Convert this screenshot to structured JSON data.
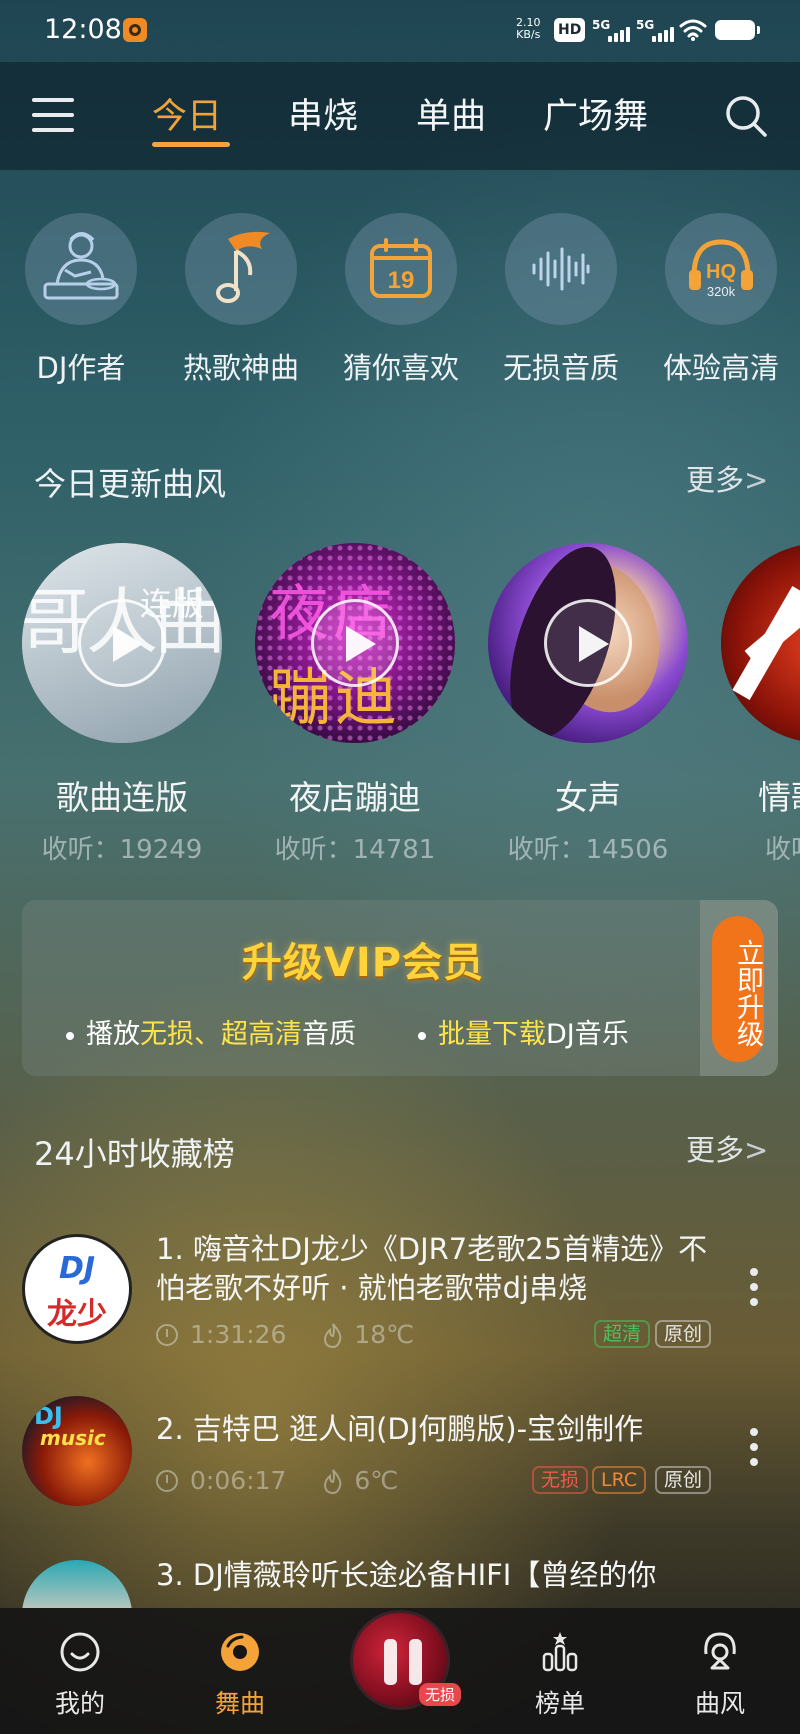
{
  "status_bar": {
    "time": "12:08",
    "net_speed_value": "2.10",
    "net_speed_unit": "KB/s",
    "hd": "HD",
    "sig1": "5G",
    "sig2": "5G"
  },
  "tabs": [
    {
      "label": "今日",
      "active": true
    },
    {
      "label": "串烧"
    },
    {
      "label": "单曲"
    },
    {
      "label": "广场舞"
    }
  ],
  "shortcuts": [
    {
      "label": "DJ作者",
      "icon": "dj-author-icon"
    },
    {
      "label": "热歌神曲",
      "icon": "hot-song-icon"
    },
    {
      "label": "猜你喜欢",
      "icon": "calendar-icon",
      "calendar_day": "19"
    },
    {
      "label": "无损音质",
      "icon": "waveform-icon"
    },
    {
      "label": "体验高清",
      "icon": "hq-headphones-icon",
      "hq": "HQ",
      "bitrate": "320k"
    }
  ],
  "styles_section": {
    "title": "今日更新曲风",
    "more": "更多",
    "more_chev": ">"
  },
  "styles": [
    {
      "name": "歌曲连版",
      "listens": "收听：19249",
      "cover_text_big": "哥人曲",
      "cover_text_small": "连版"
    },
    {
      "name": "夜店蹦迪",
      "listens": "收听：14781",
      "cover_text_top": "夜店",
      "cover_text_bottom": "蹦迪"
    },
    {
      "name": "女声",
      "listens": "收听：14506"
    },
    {
      "name": "情歌",
      "listens": "收听"
    }
  ],
  "vip": {
    "title": "升级VIP会员",
    "perk1_prefix": "播放",
    "perk1_hl1": "无损",
    "perk1_mid": "、",
    "perk1_hl2": "超高清",
    "perk1_suffix": "音质",
    "perk2_hl": "批量下载",
    "perk2_suffix": "DJ音乐",
    "upgrade": "立即升级"
  },
  "chart_section": {
    "title": "24小时收藏榜",
    "more": "更多",
    "more_chev": ">"
  },
  "songs": [
    {
      "title": "1. 嗨音社DJ龙少《DJR7老歌25首精选》不怕老歌不好听 · 就怕老歌带dj串烧",
      "duration": "1:31:26",
      "heat": "18℃",
      "badges": [
        "超清",
        "原创"
      ],
      "cover_text": "DJ",
      "cover_text2": "龙少"
    },
    {
      "title": "2. 吉特巴  逛人间(DJ何鹏版)-宝剑制作",
      "duration": "0:06:17",
      "heat": "6℃",
      "badges": [
        "无损",
        "LRC",
        "原创"
      ],
      "cover_text": "DJ",
      "cover_text2": "music"
    },
    {
      "title": "3. DJ情薇聆听长途必备HIFI【曾经的你"
    }
  ],
  "bottom_nav": [
    {
      "label": "我的",
      "icon": "smile-icon"
    },
    {
      "label": "舞曲",
      "icon": "disc-icon",
      "active": true
    },
    {
      "label": "榜单",
      "icon": "chart-ranking-icon"
    },
    {
      "label": "曲风",
      "icon": "style-location-icon"
    }
  ],
  "player": {
    "badge": "无损"
  },
  "colors": {
    "accent": "#f3a338",
    "vip_gold": "#ffd33a",
    "upgrade_orange": "#f1741b"
  }
}
